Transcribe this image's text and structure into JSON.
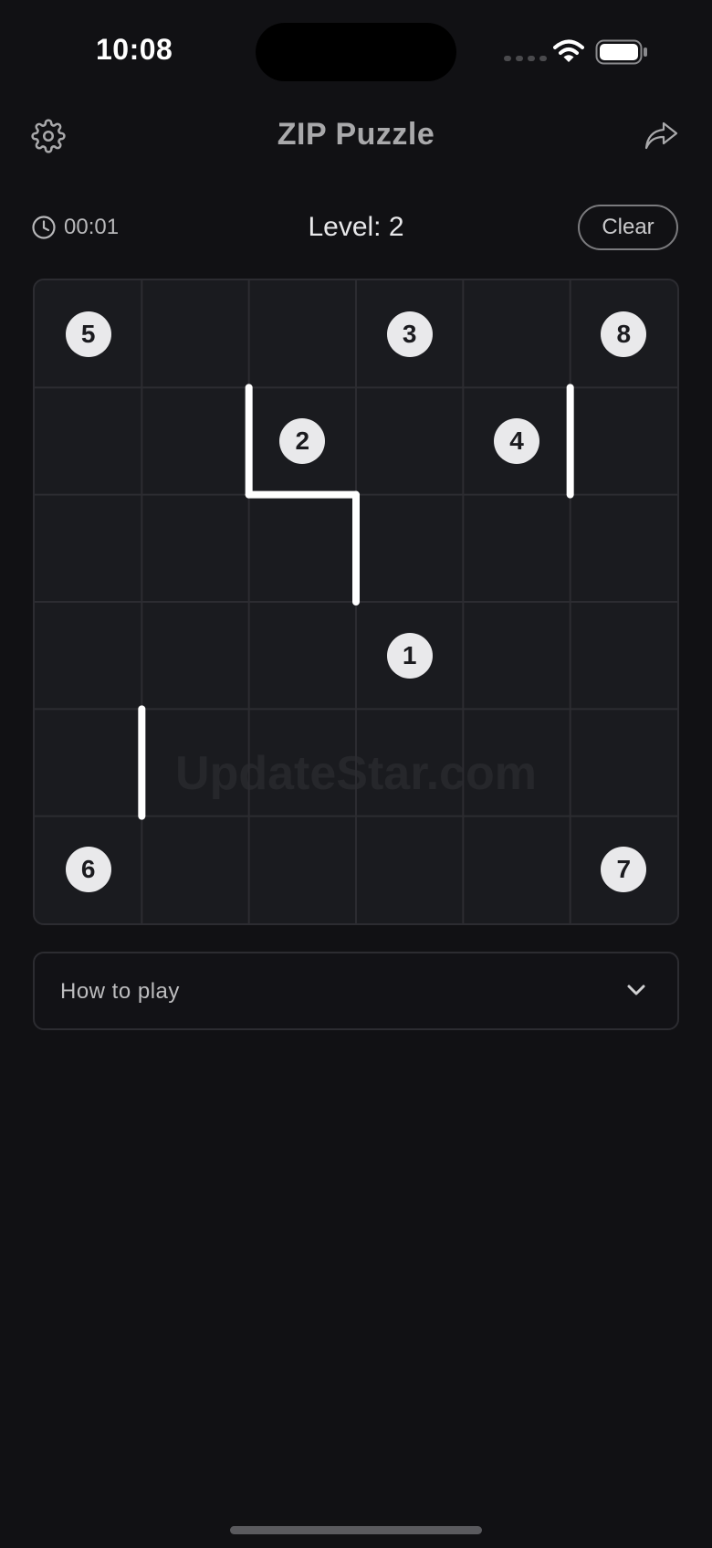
{
  "status_bar": {
    "time": "10:08"
  },
  "header": {
    "title": "ZIP Puzzle",
    "settings_icon": "gear-icon",
    "share_icon": "share-arrow-icon"
  },
  "toolbar": {
    "timer": "00:01",
    "timer_icon": "clock-icon",
    "level": "Level: 2",
    "clear_label": "Clear"
  },
  "board": {
    "rows": 6,
    "cols": 6,
    "watermark": "UpdateStar.com",
    "nodes": [
      {
        "label": "5",
        "row": 0,
        "col": 0
      },
      {
        "label": "3",
        "row": 0,
        "col": 3
      },
      {
        "label": "8",
        "row": 0,
        "col": 5
      },
      {
        "label": "2",
        "row": 1,
        "col": 2
      },
      {
        "label": "4",
        "row": 1,
        "col": 4
      },
      {
        "label": "1",
        "row": 3,
        "col": 3
      },
      {
        "label": "6",
        "row": 5,
        "col": 0
      },
      {
        "label": "7",
        "row": 5,
        "col": 5
      }
    ],
    "walls": [
      {
        "from": [
          1,
          2
        ],
        "to": [
          2,
          2
        ]
      },
      {
        "from": [
          2,
          2
        ],
        "to": [
          2,
          3
        ]
      },
      {
        "from": [
          2,
          3
        ],
        "to": [
          3,
          3
        ]
      },
      {
        "from": [
          1,
          5
        ],
        "to": [
          2,
          5
        ]
      },
      {
        "from": [
          4,
          1
        ],
        "to": [
          5,
          1
        ]
      }
    ]
  },
  "how_to_play": {
    "label": "How to play",
    "icon": "chevron-down-icon"
  },
  "colors": {
    "background": "#111114",
    "board": "#1a1b1f",
    "grid": "#2c2c31",
    "node": "#e9e9eb",
    "wall": "#ffffff"
  }
}
